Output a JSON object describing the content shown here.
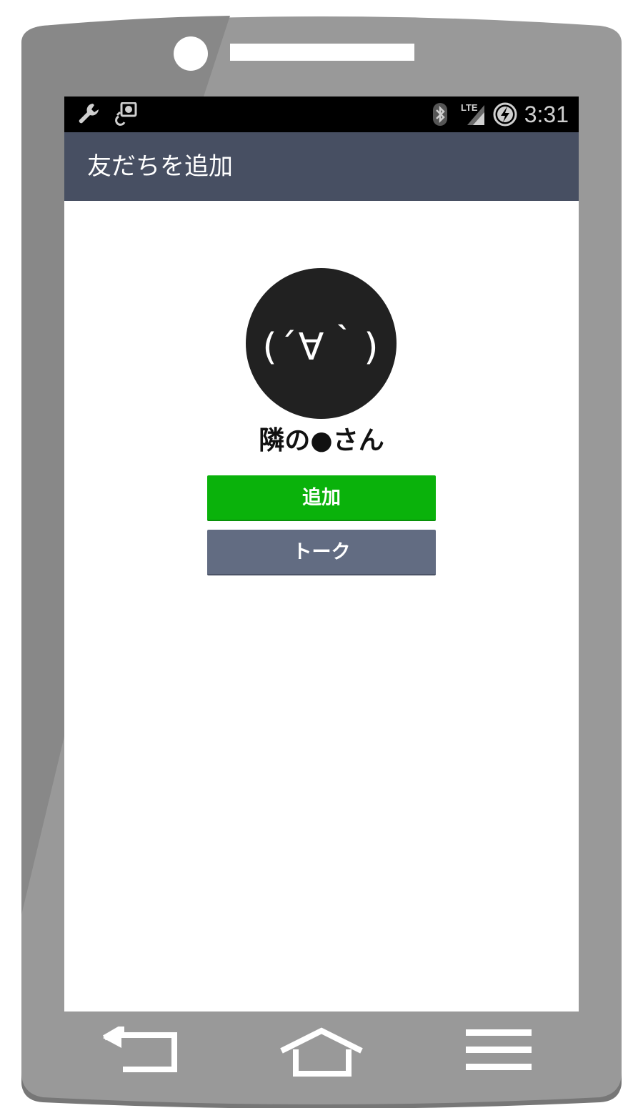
{
  "status_bar": {
    "time": "3:31",
    "network_label": "LTE",
    "left_icons": [
      "wrench-icon",
      "usb-debug-icon"
    ],
    "right_icons": [
      "bluetooth-icon",
      "signal-icon",
      "battery-charging-icon"
    ]
  },
  "app_bar": {
    "title": "友だちを追加"
  },
  "profile": {
    "avatar_text": "(´∀｀)",
    "name": "隣の●さん"
  },
  "actions": {
    "add_label": "追加",
    "talk_label": "トーク"
  },
  "nav_bar": {
    "icons": [
      "back-icon",
      "home-icon",
      "menu-icon"
    ]
  },
  "colors": {
    "app_bar": "#474f62",
    "add_button": "#0ab20b",
    "talk_button": "#626c82",
    "phone_body": "#999999"
  }
}
